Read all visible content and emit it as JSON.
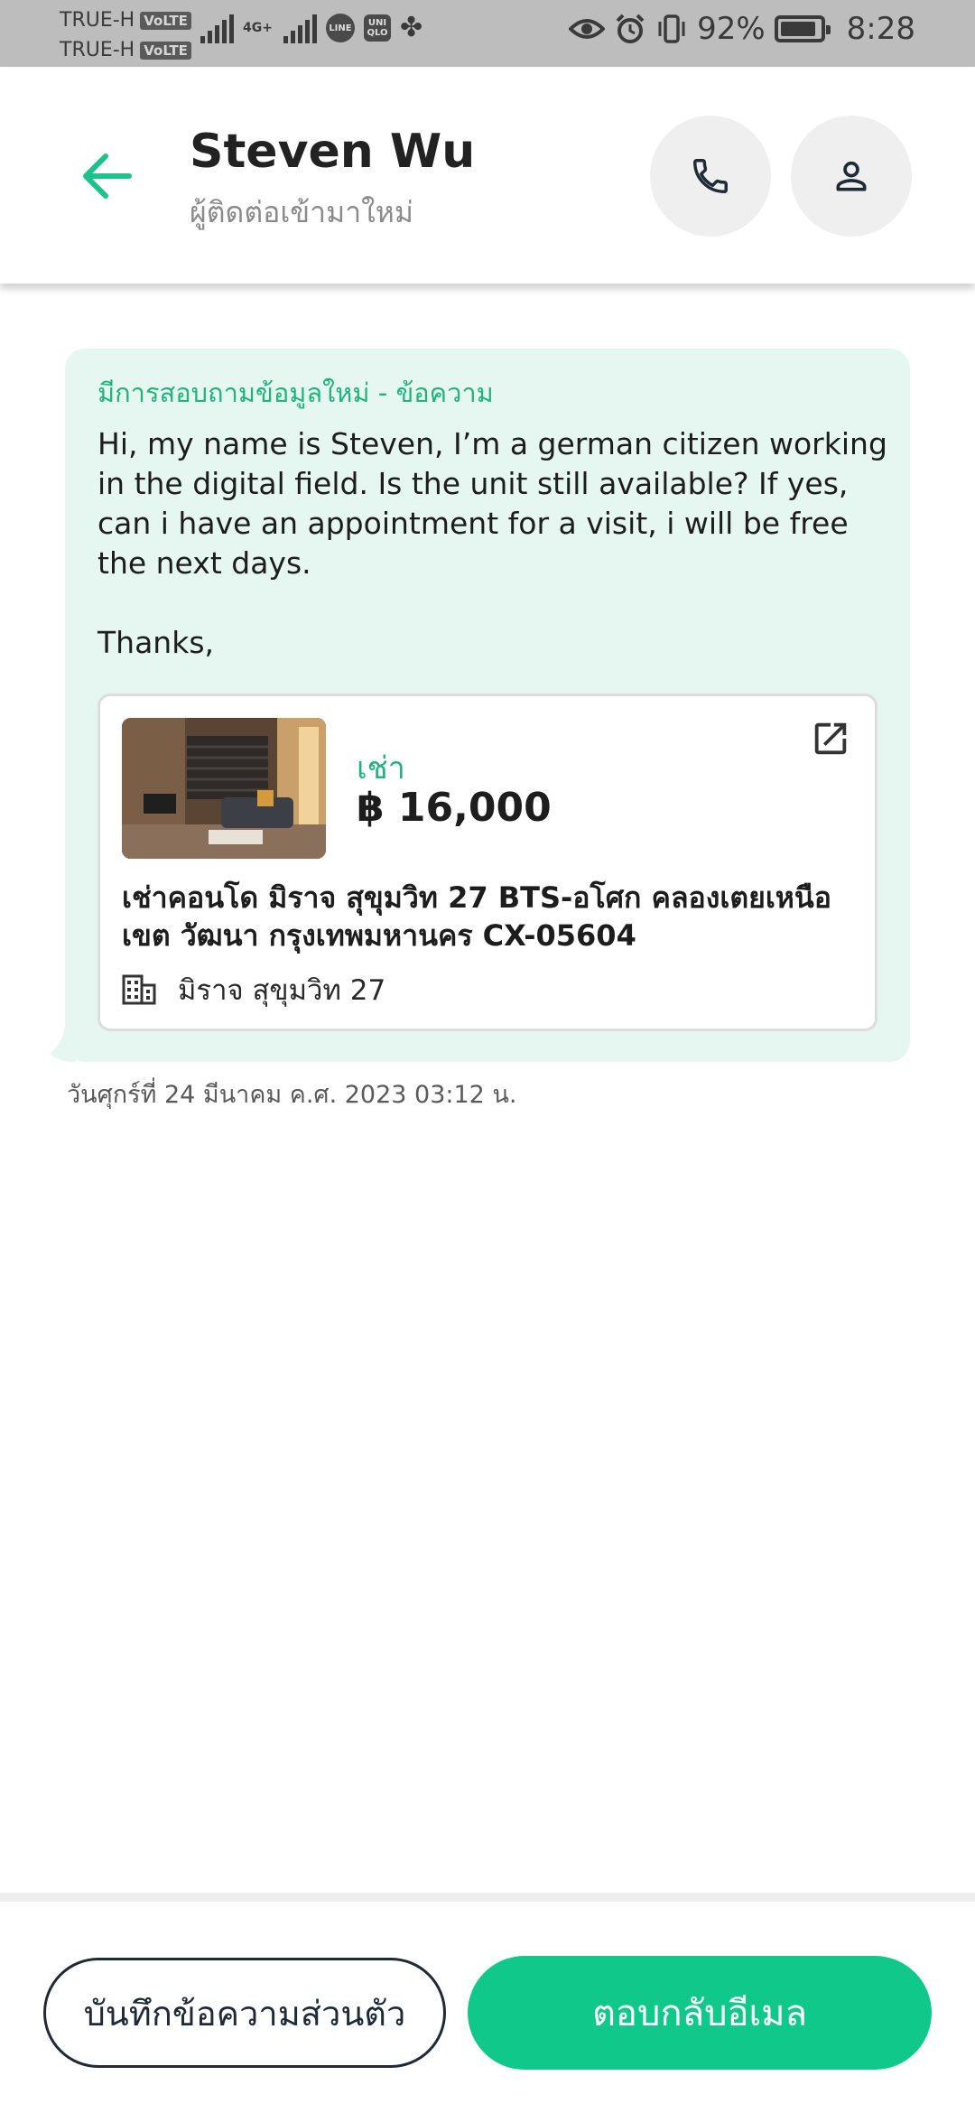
{
  "status_bar": {
    "carrier_1": "TRUE-H",
    "carrier_2": "TRUE-H",
    "volte_1": "VoLTE",
    "volte_2": "VoLTE",
    "net_type": "4G+",
    "line_icon_text": "LINE",
    "uniqlo_icon_text": "UNI QLO",
    "battery": "92%",
    "time": "8:28"
  },
  "header": {
    "contact_name": "Steven Wu",
    "contact_subtitle": "ผู้ติดต่อเข้ามาใหม่"
  },
  "message": {
    "heading": "มีการสอบถามข้อมูลใหม่ - ข้อความ",
    "body": "Hi, my name is Steven, I’m a german citizen working in the digital field. Is the unit still available? If yes, can i have an appointment for a visit, i will be free the next days.",
    "signoff": "Thanks,",
    "timestamp": "วันศุกร์ที่ 24 มีนาคม ค.ศ. 2023 03:12 น."
  },
  "listing": {
    "type": "เช่า",
    "price": "฿ 16,000",
    "title": "เช่าคอนโด มิราจ สุขุมวิท 27 BTS-อโศก คลองเตยเหนือ เขต วัฒนา กรุงเทพมหานคร CX-05604",
    "building": "มิราจ สุขุมวิท 27"
  },
  "actions": {
    "note_button": "บันทึกข้อความส่วนตัว",
    "reply_button": "ตอบกลับอีเมล"
  },
  "colors": {
    "accent": "#0fc88a",
    "bubble_bg": "#e6f7f1",
    "heading_green": "#21b37c"
  }
}
